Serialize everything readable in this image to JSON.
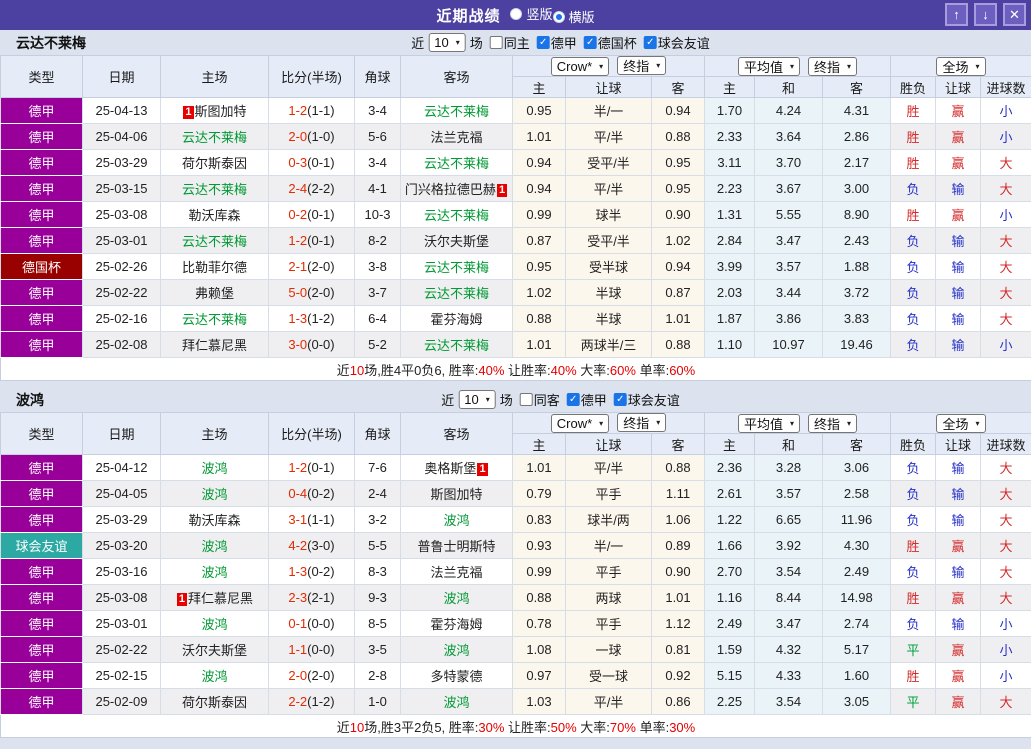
{
  "colors": {
    "titlebar": "#4c41a0",
    "league": {
      "德甲": "#990099",
      "德国杯": "#990000",
      "球会友谊": "#2ca9a2"
    },
    "team_highlight": "#009933",
    "score": "#e32b00",
    "status": {
      "r": "#d42b2b",
      "b": "#2530c8",
      "g": "#00a040"
    },
    "summary_highlight": "#e60000",
    "checkbox": "#1a74e8"
  },
  "titlebar": {
    "title": "近期战绩",
    "radios": [
      {
        "label": "竖版",
        "selected": false
      },
      {
        "label": "横版",
        "selected": true
      }
    ],
    "buttons": [
      {
        "name": "move-up-button",
        "glyph": "↑"
      },
      {
        "name": "move-down-button",
        "glyph": "↓"
      },
      {
        "name": "close-button",
        "glyph": "✕"
      }
    ]
  },
  "table_header": {
    "left_columns": [
      "类型",
      "日期",
      "主场",
      "比分(半场)",
      "角球",
      "客场"
    ],
    "groups": [
      {
        "selects": [
          "Crow*",
          "终指"
        ],
        "subs": [
          "主",
          "让球",
          "客"
        ]
      },
      {
        "selects": [
          "平均值",
          "终指"
        ],
        "subs": [
          "主",
          "和",
          "客"
        ]
      },
      {
        "selects": [
          "全场"
        ],
        "subs": [
          "胜负",
          "让球",
          "进球数"
        ]
      }
    ]
  },
  "sections": [
    {
      "team": "云达不莱梅",
      "filter": {
        "near": "近",
        "games": "10",
        "unit": "场",
        "checkboxes": [
          {
            "label": "同主",
            "checked": false
          },
          {
            "label": "德甲",
            "checked": true
          },
          {
            "label": "德国杯",
            "checked": true
          },
          {
            "label": "球会友谊",
            "checked": true
          }
        ]
      },
      "rows": [
        {
          "league": "德甲",
          "date": "25-04-13",
          "home": "斯图加特",
          "home_green": false,
          "home_badge": "1",
          "score_ft": "1-2",
          "score_ht": "(1-1)",
          "corner": "3-4",
          "away": "云达不莱梅",
          "away_green": true,
          "away_badge": "",
          "handicap": [
            "0.95",
            "半/一",
            "0.94"
          ],
          "avg": [
            "1.70",
            "4.24",
            "4.31"
          ],
          "outcome": [
            [
              "胜",
              "r"
            ],
            [
              "赢",
              "r"
            ],
            [
              "小",
              "b"
            ]
          ]
        },
        {
          "league": "德甲",
          "date": "25-04-06",
          "home": "云达不莱梅",
          "home_green": true,
          "home_badge": "",
          "score_ft": "2-0",
          "score_ht": "(1-0)",
          "corner": "5-6",
          "away": "法兰克福",
          "away_green": false,
          "away_badge": "",
          "handicap": [
            "1.01",
            "平/半",
            "0.88"
          ],
          "avg": [
            "2.33",
            "3.64",
            "2.86"
          ],
          "outcome": [
            [
              "胜",
              "r"
            ],
            [
              "赢",
              "r"
            ],
            [
              "小",
              "b"
            ]
          ]
        },
        {
          "league": "德甲",
          "date": "25-03-29",
          "home": "荷尔斯泰因",
          "home_green": false,
          "home_badge": "",
          "score_ft": "0-3",
          "score_ht": "(0-1)",
          "corner": "3-4",
          "away": "云达不莱梅",
          "away_green": true,
          "away_badge": "",
          "handicap": [
            "0.94",
            "受平/半",
            "0.95"
          ],
          "avg": [
            "3.11",
            "3.70",
            "2.17"
          ],
          "outcome": [
            [
              "胜",
              "r"
            ],
            [
              "赢",
              "r"
            ],
            [
              "大",
              "r"
            ]
          ]
        },
        {
          "league": "德甲",
          "date": "25-03-15",
          "home": "云达不莱梅",
          "home_green": true,
          "home_badge": "",
          "score_ft": "2-4",
          "score_ht": "(2-2)",
          "corner": "4-1",
          "away": "门兴格拉德巴赫",
          "away_green": false,
          "away_badge": "1",
          "handicap": [
            "0.94",
            "平/半",
            "0.95"
          ],
          "avg": [
            "2.23",
            "3.67",
            "3.00"
          ],
          "outcome": [
            [
              "负",
              "b"
            ],
            [
              "输",
              "b"
            ],
            [
              "大",
              "r"
            ]
          ]
        },
        {
          "league": "德甲",
          "date": "25-03-08",
          "home": "勒沃库森",
          "home_green": false,
          "home_badge": "",
          "score_ft": "0-2",
          "score_ht": "(0-1)",
          "corner": "10-3",
          "away": "云达不莱梅",
          "away_green": true,
          "away_badge": "",
          "handicap": [
            "0.99",
            "球半",
            "0.90"
          ],
          "avg": [
            "1.31",
            "5.55",
            "8.90"
          ],
          "outcome": [
            [
              "胜",
              "r"
            ],
            [
              "赢",
              "r"
            ],
            [
              "小",
              "b"
            ]
          ]
        },
        {
          "league": "德甲",
          "date": "25-03-01",
          "home": "云达不莱梅",
          "home_green": true,
          "home_badge": "",
          "score_ft": "1-2",
          "score_ht": "(0-1)",
          "corner": "8-2",
          "away": "沃尔夫斯堡",
          "away_green": false,
          "away_badge": "",
          "handicap": [
            "0.87",
            "受平/半",
            "1.02"
          ],
          "avg": [
            "2.84",
            "3.47",
            "2.43"
          ],
          "outcome": [
            [
              "负",
              "b"
            ],
            [
              "输",
              "b"
            ],
            [
              "大",
              "r"
            ]
          ]
        },
        {
          "league": "德国杯",
          "date": "25-02-26",
          "home": "比勒菲尔德",
          "home_green": false,
          "home_badge": "",
          "score_ft": "2-1",
          "score_ht": "(2-0)",
          "corner": "3-8",
          "away": "云达不莱梅",
          "away_green": true,
          "away_badge": "",
          "handicap": [
            "0.95",
            "受半球",
            "0.94"
          ],
          "avg": [
            "3.99",
            "3.57",
            "1.88"
          ],
          "outcome": [
            [
              "负",
              "b"
            ],
            [
              "输",
              "b"
            ],
            [
              "大",
              "r"
            ]
          ]
        },
        {
          "league": "德甲",
          "date": "25-02-22",
          "home": "弗赖堡",
          "home_green": false,
          "home_badge": "",
          "score_ft": "5-0",
          "score_ht": "(2-0)",
          "corner": "3-7",
          "away": "云达不莱梅",
          "away_green": true,
          "away_badge": "",
          "handicap": [
            "1.02",
            "半球",
            "0.87"
          ],
          "avg": [
            "2.03",
            "3.44",
            "3.72"
          ],
          "outcome": [
            [
              "负",
              "b"
            ],
            [
              "输",
              "b"
            ],
            [
              "大",
              "r"
            ]
          ]
        },
        {
          "league": "德甲",
          "date": "25-02-16",
          "home": "云达不莱梅",
          "home_green": true,
          "home_badge": "",
          "score_ft": "1-3",
          "score_ht": "(1-2)",
          "corner": "6-4",
          "away": "霍芬海姆",
          "away_green": false,
          "away_badge": "",
          "handicap": [
            "0.88",
            "半球",
            "1.01"
          ],
          "avg": [
            "1.87",
            "3.86",
            "3.83"
          ],
          "outcome": [
            [
              "负",
              "b"
            ],
            [
              "输",
              "b"
            ],
            [
              "大",
              "r"
            ]
          ]
        },
        {
          "league": "德甲",
          "date": "25-02-08",
          "home": "拜仁慕尼黑",
          "home_green": false,
          "home_badge": "",
          "score_ft": "3-0",
          "score_ht": "(0-0)",
          "corner": "5-2",
          "away": "云达不莱梅",
          "away_green": true,
          "away_badge": "",
          "handicap": [
            "1.01",
            "两球半/三",
            "0.88"
          ],
          "avg": [
            "1.10",
            "10.97",
            "19.46"
          ],
          "outcome": [
            [
              "负",
              "b"
            ],
            [
              "输",
              "b"
            ],
            [
              "小",
              "b"
            ]
          ]
        }
      ],
      "summary": [
        [
          "近",
          0
        ],
        [
          "10",
          1
        ],
        [
          "场,胜4平0负6, 胜率:",
          0
        ],
        [
          "40%",
          1
        ],
        [
          " 让胜率:",
          0
        ],
        [
          "40%",
          1
        ],
        [
          " 大率:",
          0
        ],
        [
          "60%",
          1
        ],
        [
          " 单率:",
          0
        ],
        [
          "60%",
          1
        ]
      ]
    },
    {
      "team": "波鸿",
      "filter": {
        "near": "近",
        "games": "10",
        "unit": "场",
        "checkboxes": [
          {
            "label": "同客",
            "checked": false
          },
          {
            "label": "德甲",
            "checked": true
          },
          {
            "label": "球会友谊",
            "checked": true
          }
        ]
      },
      "rows": [
        {
          "league": "德甲",
          "date": "25-04-12",
          "home": "波鸿",
          "home_green": true,
          "home_badge": "",
          "score_ft": "1-2",
          "score_ht": "(0-1)",
          "corner": "7-6",
          "away": "奥格斯堡",
          "away_green": false,
          "away_badge": "1",
          "handicap": [
            "1.01",
            "平/半",
            "0.88"
          ],
          "avg": [
            "2.36",
            "3.28",
            "3.06"
          ],
          "outcome": [
            [
              "负",
              "b"
            ],
            [
              "输",
              "b"
            ],
            [
              "大",
              "r"
            ]
          ]
        },
        {
          "league": "德甲",
          "date": "25-04-05",
          "home": "波鸿",
          "home_green": true,
          "home_badge": "",
          "score_ft": "0-4",
          "score_ht": "(0-2)",
          "corner": "2-4",
          "away": "斯图加特",
          "away_green": false,
          "away_badge": "",
          "handicap": [
            "0.79",
            "平手",
            "1.11"
          ],
          "avg": [
            "2.61",
            "3.57",
            "2.58"
          ],
          "outcome": [
            [
              "负",
              "b"
            ],
            [
              "输",
              "b"
            ],
            [
              "大",
              "r"
            ]
          ]
        },
        {
          "league": "德甲",
          "date": "25-03-29",
          "home": "勒沃库森",
          "home_green": false,
          "home_badge": "",
          "score_ft": "3-1",
          "score_ht": "(1-1)",
          "corner": "3-2",
          "away": "波鸿",
          "away_green": true,
          "away_badge": "",
          "handicap": [
            "0.83",
            "球半/两",
            "1.06"
          ],
          "avg": [
            "1.22",
            "6.65",
            "11.96"
          ],
          "outcome": [
            [
              "负",
              "b"
            ],
            [
              "输",
              "b"
            ],
            [
              "大",
              "r"
            ]
          ]
        },
        {
          "league": "球会友谊",
          "date": "25-03-20",
          "home": "波鸿",
          "home_green": true,
          "home_badge": "",
          "score_ft": "4-2",
          "score_ht": "(3-0)",
          "corner": "5-5",
          "away": "普鲁士明斯特",
          "away_green": false,
          "away_badge": "",
          "handicap": [
            "0.93",
            "半/一",
            "0.89"
          ],
          "avg": [
            "1.66",
            "3.92",
            "4.30"
          ],
          "outcome": [
            [
              "胜",
              "r"
            ],
            [
              "赢",
              "r"
            ],
            [
              "大",
              "r"
            ]
          ]
        },
        {
          "league": "德甲",
          "date": "25-03-16",
          "home": "波鸿",
          "home_green": true,
          "home_badge": "",
          "score_ft": "1-3",
          "score_ht": "(0-2)",
          "corner": "8-3",
          "away": "法兰克福",
          "away_green": false,
          "away_badge": "",
          "handicap": [
            "0.99",
            "平手",
            "0.90"
          ],
          "avg": [
            "2.70",
            "3.54",
            "2.49"
          ],
          "outcome": [
            [
              "负",
              "b"
            ],
            [
              "输",
              "b"
            ],
            [
              "大",
              "r"
            ]
          ]
        },
        {
          "league": "德甲",
          "date": "25-03-08",
          "home": "拜仁慕尼黑",
          "home_green": false,
          "home_badge": "1",
          "score_ft": "2-3",
          "score_ht": "(2-1)",
          "corner": "9-3",
          "away": "波鸿",
          "away_green": true,
          "away_badge": "",
          "handicap": [
            "0.88",
            "两球",
            "1.01"
          ],
          "avg": [
            "1.16",
            "8.44",
            "14.98"
          ],
          "outcome": [
            [
              "胜",
              "r"
            ],
            [
              "赢",
              "r"
            ],
            [
              "大",
              "r"
            ]
          ]
        },
        {
          "league": "德甲",
          "date": "25-03-01",
          "home": "波鸿",
          "home_green": true,
          "home_badge": "",
          "score_ft": "0-1",
          "score_ht": "(0-0)",
          "corner": "8-5",
          "away": "霍芬海姆",
          "away_green": false,
          "away_badge": "",
          "handicap": [
            "0.78",
            "平手",
            "1.12"
          ],
          "avg": [
            "2.49",
            "3.47",
            "2.74"
          ],
          "outcome": [
            [
              "负",
              "b"
            ],
            [
              "输",
              "b"
            ],
            [
              "小",
              "b"
            ]
          ]
        },
        {
          "league": "德甲",
          "date": "25-02-22",
          "home": "沃尔夫斯堡",
          "home_green": false,
          "home_badge": "",
          "score_ft": "1-1",
          "score_ht": "(0-0)",
          "corner": "3-5",
          "away": "波鸿",
          "away_green": true,
          "away_badge": "",
          "handicap": [
            "1.08",
            "一球",
            "0.81"
          ],
          "avg": [
            "1.59",
            "4.32",
            "5.17"
          ],
          "outcome": [
            [
              "平",
              "g"
            ],
            [
              "赢",
              "r"
            ],
            [
              "小",
              "b"
            ]
          ]
        },
        {
          "league": "德甲",
          "date": "25-02-15",
          "home": "波鸿",
          "home_green": true,
          "home_badge": "",
          "score_ft": "2-0",
          "score_ht": "(2-0)",
          "corner": "2-8",
          "away": "多特蒙德",
          "away_green": false,
          "away_badge": "",
          "handicap": [
            "0.97",
            "受一球",
            "0.92"
          ],
          "avg": [
            "5.15",
            "4.33",
            "1.60"
          ],
          "outcome": [
            [
              "胜",
              "r"
            ],
            [
              "赢",
              "r"
            ],
            [
              "小",
              "b"
            ]
          ]
        },
        {
          "league": "德甲",
          "date": "25-02-09",
          "home": "荷尔斯泰因",
          "home_green": false,
          "home_badge": "",
          "score_ft": "2-2",
          "score_ht": "(1-2)",
          "corner": "1-0",
          "away": "波鸿",
          "away_green": true,
          "away_badge": "",
          "handicap": [
            "1.03",
            "平/半",
            "0.86"
          ],
          "avg": [
            "2.25",
            "3.54",
            "3.05"
          ],
          "outcome": [
            [
              "平",
              "g"
            ],
            [
              "赢",
              "r"
            ],
            [
              "大",
              "r"
            ]
          ]
        }
      ],
      "summary": [
        [
          "近",
          0
        ],
        [
          "10",
          1
        ],
        [
          "场,胜3平2负5, 胜率:",
          0
        ],
        [
          "30%",
          1
        ],
        [
          " 让胜率:",
          0
        ],
        [
          "50%",
          1
        ],
        [
          " 大率:",
          0
        ],
        [
          "70%",
          1
        ],
        [
          " 单率:",
          0
        ],
        [
          "30%",
          1
        ]
      ]
    }
  ]
}
